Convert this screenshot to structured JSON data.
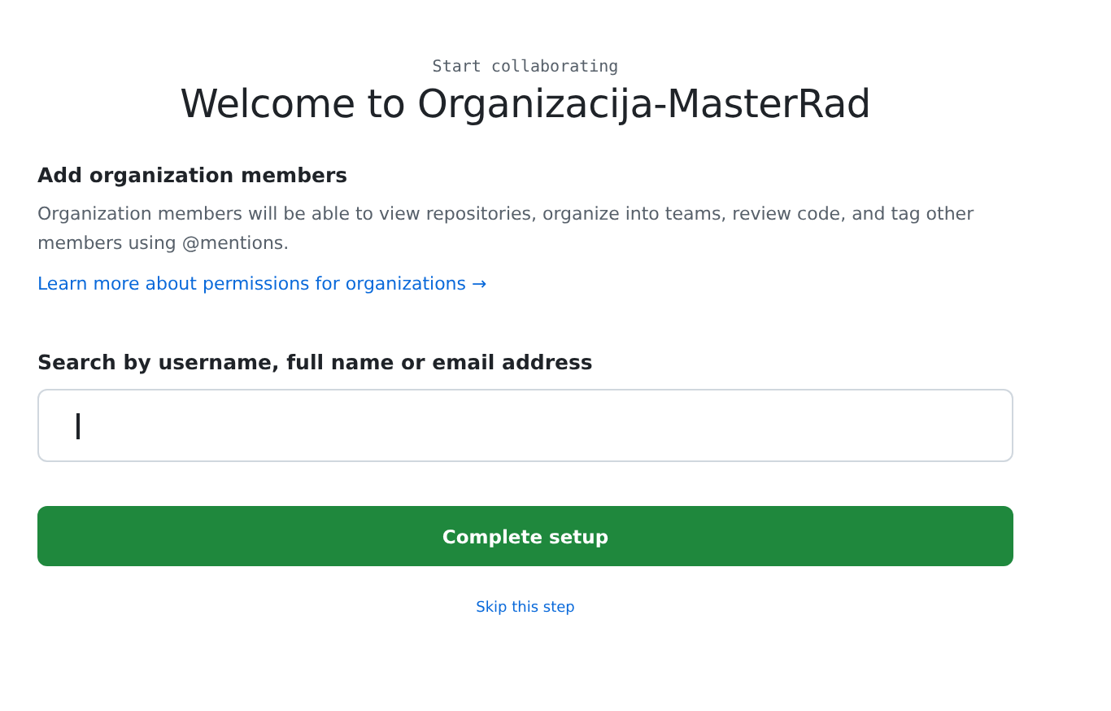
{
  "eyebrow": "Start collaborating",
  "title": "Welcome to Organizacija-MasterRad",
  "section": {
    "heading": "Add organization members",
    "description": "Organization members will be able to view repositories, organize into teams, review code, and tag other members using @mentions.",
    "link": "Learn more about permissions for organizations →"
  },
  "search": {
    "label": "Search by username, full name or email address",
    "focused": true
  },
  "primary_button": "Complete setup",
  "skip_link": "Skip this step"
}
